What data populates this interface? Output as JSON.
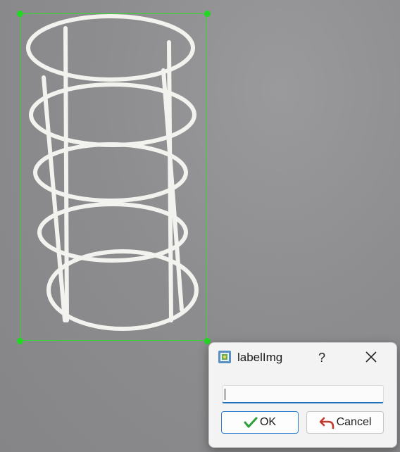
{
  "annotation": {
    "box_color": "#39d639"
  },
  "dialog": {
    "title": "labelImg",
    "help_label": "?",
    "input": {
      "value": "",
      "placeholder": ""
    },
    "ok_label": "OK",
    "cancel_label": "Cancel",
    "icons": {
      "app": "labelimg-app-icon",
      "close": "close-icon",
      "ok": "check-icon",
      "cancel": "undo-arrow-icon"
    },
    "accent": "#1d6fb8"
  }
}
